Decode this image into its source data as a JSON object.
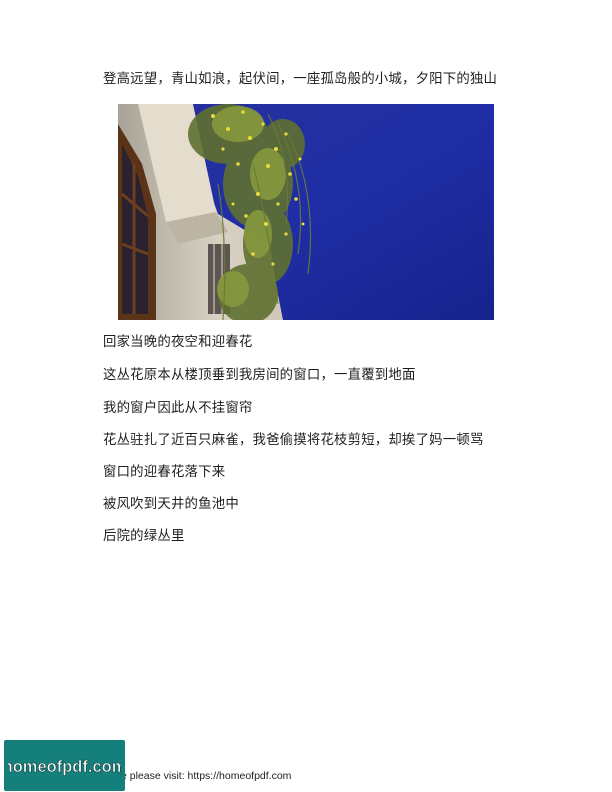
{
  "document": {
    "lines": [
      "登高远望，青山如浪，起伏间，一座孤岛般的小城，夕阳下的独山",
      "回家当晚的夜空和迎春花",
      "这丛花原本从楼顶垂到我房间的窗口，一直覆到地面",
      "我的窗户因此从不挂窗帘",
      "花丛驻扎了近百只麻雀，我爸偷摸将花枝剪短，却挨了妈一顿骂",
      "窗口的迎春花落下来",
      "被风吹到天井的鱼池中",
      "后院的绿丛里"
    ]
  },
  "footer": {
    "text": "e please visit: https://homeofpdf.com",
    "logo_text": "homeofpdf.com"
  },
  "colors": {
    "logo_bg": "#157f7c",
    "sky": "#1f2fa0",
    "wall": "#d9d2c4",
    "window_frame": "#6b3f1f",
    "leaves": "#7d8f3a",
    "flowers": "#e6dc3c"
  }
}
